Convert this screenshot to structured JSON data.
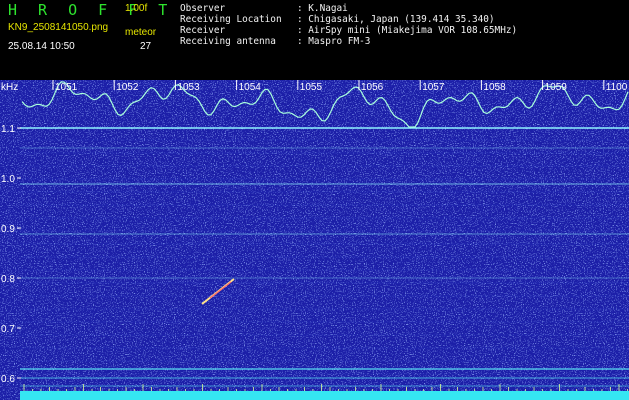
{
  "header": {
    "app_title": "H R O F F T",
    "version": "1.00f",
    "filename": "KN9_2508141050.png",
    "datetime": "25.08.14 10:50",
    "counter_type": "meteor",
    "counter_value": "27"
  },
  "observation": [
    {
      "label": "Observer",
      "value": ": K.Nagai"
    },
    {
      "label": "Receiving Location",
      "value": ": Chigasaki, Japan (139.414 35.340)"
    },
    {
      "label": "Receiver",
      "value": ": AirSpy mini (Miakejima VOR 108.65MHz)"
    },
    {
      "label": "Receiving antenna",
      "value": ": Maspro FM-3"
    }
  ],
  "spectrogram": {
    "unit_label": "kHz",
    "freq_ticks": [
      "1.1",
      "1.0",
      "0.9",
      "0.8",
      "0.7",
      "0.6"
    ],
    "time_ticks": [
      "1051",
      "1052",
      "1053",
      "1054",
      "1055",
      "1056",
      "1057",
      "1058",
      "1059",
      "1100"
    ],
    "colors": {
      "background": "#1c1fa8",
      "noise": "#3d52d8",
      "line": "#8ff4ff",
      "baseline": "#5be8f5",
      "trace": "#a8ffdc",
      "label": "#ffffff"
    }
  }
}
